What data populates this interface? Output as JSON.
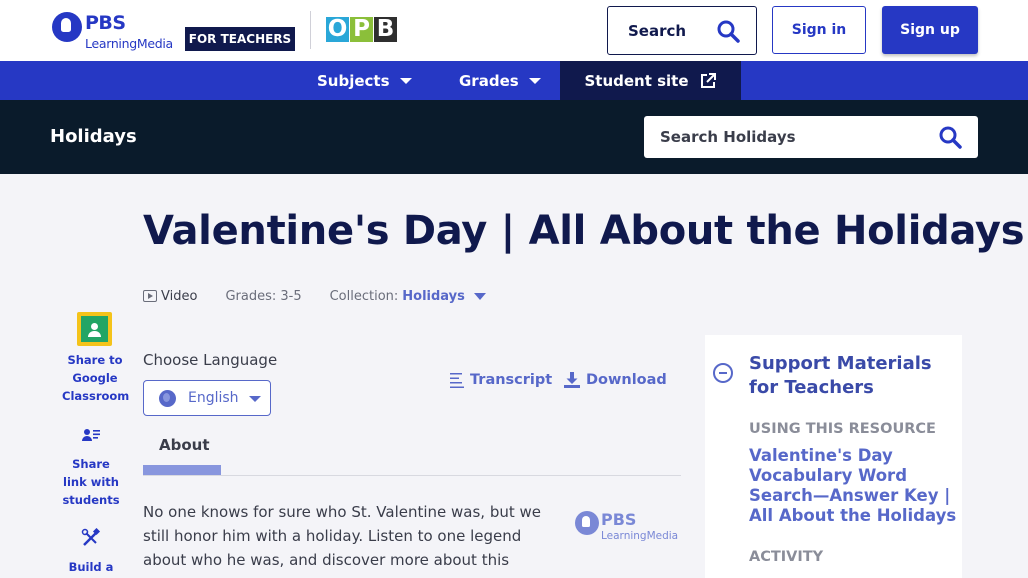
{
  "header": {
    "logo_text": "PBS",
    "logo_subtext": "LearningMedia",
    "teachers_badge": "FOR TEACHERS",
    "partner_logo": "OPB",
    "search_label": "Search",
    "signin_label": "Sign in",
    "signup_label": "Sign up"
  },
  "nav": {
    "items": [
      {
        "label": "Subjects"
      },
      {
        "label": "Grades"
      }
    ],
    "student_site": "Student site"
  },
  "section": {
    "title": "Holidays",
    "search_placeholder": "Search Holidays"
  },
  "resource": {
    "title": "Valentine's Day | All About the Holidays",
    "type": "Video",
    "grades": "Grades: 3-5",
    "collection_label": "Collection:",
    "collection_value": "Holidays"
  },
  "share": {
    "google_classroom": "Share to Google Classroom",
    "share_link": "Share link with students",
    "build": "Build a"
  },
  "language": {
    "label": "Choose Language",
    "selected": "English"
  },
  "actions": {
    "transcript": "Transcript",
    "download": "Download"
  },
  "tabs": {
    "about": "About"
  },
  "description": "No one knows for sure who St. Valentine was, but we still honor him with a holiday. Listen to one legend about who he was, and discover more about this",
  "support": {
    "title": "Support Materials for Teachers",
    "using_heading": "USING THIS RESOURCE",
    "link": "Valentine's Day Vocabulary Word Search—Answer Key | All About the Holidays",
    "activity_heading": "ACTIVITY"
  },
  "colors": {
    "brand_blue": "#2638c4",
    "navy": "#10194d",
    "section_bg": "#0a1b2b",
    "link": "#5768c9"
  }
}
